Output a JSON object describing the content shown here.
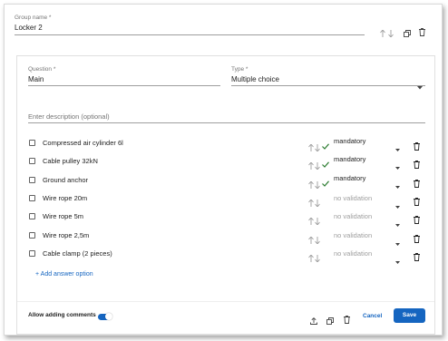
{
  "group": {
    "label": "Group name *",
    "value": "Locker 2"
  },
  "question": {
    "label": "Question *",
    "value": "Main",
    "type_label": "Type *",
    "type_value": "Multiple choice",
    "description_placeholder": "Enter description (optional)"
  },
  "options": [
    {
      "label": "Compressed air cylinder 6l",
      "validation": "mandatory",
      "checked_green": true
    },
    {
      "label": "Cable pulley 32kN",
      "validation": "mandatory",
      "checked_green": true
    },
    {
      "label": "Ground anchor",
      "validation": "mandatory",
      "checked_green": true
    },
    {
      "label": "Wire rope 20m",
      "validation": "no validation",
      "checked_green": false
    },
    {
      "label": "Wire rope 5m",
      "validation": "no validation",
      "checked_green": false
    },
    {
      "label": "Wire rope 2,5m",
      "validation": "no validation",
      "checked_green": false
    },
    {
      "label": "Cable clamp (2 pieces)",
      "validation": "no validation",
      "checked_green": false
    }
  ],
  "add_option": "+ Add answer option",
  "footer": {
    "allow_comments_label": "Allow adding comments",
    "allow_comments_on": true,
    "cancel_label": "Cancel",
    "save_label": "Save"
  },
  "colors": {
    "accent": "#1565c0",
    "check_green": "#2e7d32"
  }
}
